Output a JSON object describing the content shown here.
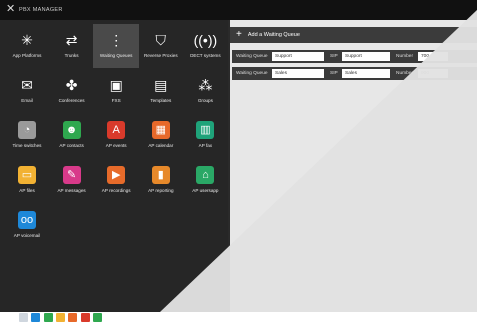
{
  "window": {
    "title": "PBX MANAGER",
    "close_glyph": "✕"
  },
  "apps": [
    {
      "label": "App Platforms",
      "icon": "app-platforms-icon",
      "glyph": "✳",
      "color": "transparent",
      "active": false
    },
    {
      "label": "Trunks",
      "icon": "trunks-icon",
      "glyph": "⇄",
      "color": "transparent",
      "active": false
    },
    {
      "label": "Waiting Queues",
      "icon": "waiting-queues-icon",
      "glyph": "⋮",
      "color": "transparent",
      "active": true
    },
    {
      "label": "Reverse Proxies",
      "icon": "reverse-proxies-icon",
      "glyph": "⛉",
      "color": "transparent",
      "active": false
    },
    {
      "label": "DECT systems",
      "icon": "dect-icon",
      "glyph": "((•))",
      "color": "transparent",
      "active": false
    },
    {
      "label": "Email",
      "icon": "email-icon",
      "glyph": "✉",
      "color": "transparent",
      "active": false
    },
    {
      "label": "Conferences",
      "icon": "conferences-icon",
      "glyph": "✤",
      "color": "transparent",
      "active": false
    },
    {
      "label": "FXS",
      "icon": "fxs-icon",
      "glyph": "▣",
      "color": "transparent",
      "active": false
    },
    {
      "label": "Templates",
      "icon": "templates-icon",
      "glyph": "▤",
      "color": "transparent",
      "active": false
    },
    {
      "label": "Groups",
      "icon": "groups-icon",
      "glyph": "⁂",
      "color": "transparent",
      "active": false
    },
    {
      "label": "Time switches",
      "icon": "time-switches-icon",
      "glyph": "◔",
      "color": "#9a9a9a",
      "active": false
    },
    {
      "label": "AP contacts",
      "icon": "ap-contacts-icon",
      "glyph": "☻",
      "color": "#2fa84f",
      "active": false
    },
    {
      "label": "AP events",
      "icon": "ap-events-icon",
      "glyph": "A",
      "color": "#d93a2b",
      "active": false
    },
    {
      "label": "AP calendar",
      "icon": "ap-calendar-icon",
      "glyph": "▦",
      "color": "#e7692a",
      "active": false
    },
    {
      "label": "AP fax",
      "icon": "ap-fax-icon",
      "glyph": "▥",
      "color": "#1fa37a",
      "active": false
    },
    {
      "label": "AP files",
      "icon": "ap-files-icon",
      "glyph": "▭",
      "color": "#f2b233",
      "active": false
    },
    {
      "label": "AP messages",
      "icon": "ap-messages-icon",
      "glyph": "✎",
      "color": "#d83a8a",
      "active": false
    },
    {
      "label": "AP recordings",
      "icon": "ap-recordings-icon",
      "glyph": "▶",
      "color": "#e76b2a",
      "active": false
    },
    {
      "label": "AP reporting",
      "icon": "ap-reporting-icon",
      "glyph": "▮",
      "color": "#e7892a",
      "active": false
    },
    {
      "label": "AP usersapp",
      "icon": "ap-usersapp-icon",
      "glyph": "⌂",
      "color": "#2aa866",
      "active": false
    },
    {
      "label": "AP voicemail",
      "icon": "ap-voicemail-icon",
      "glyph": "oo",
      "color": "#1e88d8",
      "active": false
    }
  ],
  "panel": {
    "add_label": "Add a Waiting Queue",
    "queues": [
      {
        "queue_label": "Waiting Queue",
        "queue_value": "Support",
        "sip_label": "SIP",
        "sip_value": "Support",
        "number_label": "Number",
        "number_value": "700"
      },
      {
        "queue_label": "Waiting Queue",
        "queue_value": "Sales",
        "sip_label": "SIP",
        "sip_value": "Sales",
        "number_label": "Number",
        "number_value": "900"
      }
    ]
  },
  "taskbar": [
    {
      "icon": "taskbar-app-1-icon",
      "color": "#cfd6de"
    },
    {
      "icon": "taskbar-app-2-icon",
      "color": "#1e88d8"
    },
    {
      "icon": "taskbar-app-3-icon",
      "color": "#2fa84f"
    },
    {
      "icon": "taskbar-app-4-icon",
      "color": "#f2b233"
    },
    {
      "icon": "taskbar-app-5-icon",
      "color": "#e7692a"
    },
    {
      "icon": "taskbar-app-6-icon",
      "color": "#d93a2b"
    },
    {
      "icon": "taskbar-app-7-icon",
      "color": "#2fa84f"
    }
  ]
}
